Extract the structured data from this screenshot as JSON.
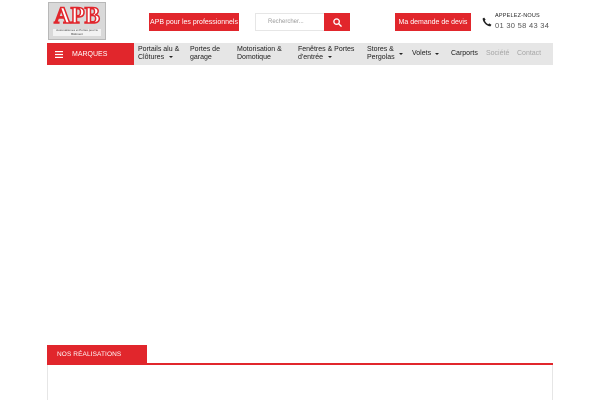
{
  "logo": {
    "text": "APB",
    "tagline": "Automatismes et Portes pour le Bâtiment"
  },
  "header": {
    "pro_button": "APB pour les professionnels",
    "search_placeholder": "Rechercher...",
    "devis_button": "Ma demande de devis",
    "phone_label": "APPELEZ-NOUS",
    "phone_number": "01 30 58 43 34"
  },
  "nav": {
    "marques": "MARQUES",
    "items": [
      {
        "line1": "Portails alu &",
        "line2": "Clôtures"
      },
      {
        "line1": "Portes de",
        "line2": "garage"
      },
      {
        "line1": "Motorisation &",
        "line2": "Domotique"
      },
      {
        "line1": "Fenêtres & Portes",
        "line2": "d'entrée"
      },
      {
        "line1": "Stores &",
        "line2": "Pergolas"
      },
      {
        "line1": "Volets"
      },
      {
        "line1": "Carports"
      },
      {
        "line1": "Société"
      },
      {
        "line1": "Contact"
      }
    ]
  },
  "section": {
    "title": "NOS RÉALISATIONS"
  },
  "colors": {
    "accent": "#e1262c",
    "nav_bg": "#e6e6e6",
    "muted_text": "#a6a6a6"
  },
  "icons": {
    "search": "search-icon",
    "phone": "phone-icon",
    "menu": "hamburger-icon",
    "dropdown": "caret-down-icon"
  }
}
